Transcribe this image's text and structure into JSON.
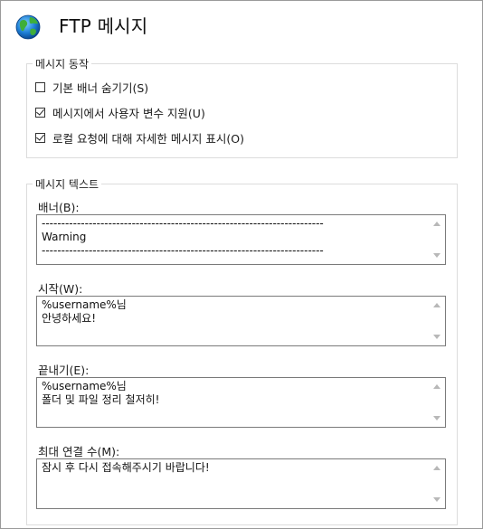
{
  "window": {
    "title": "FTP 메시지",
    "icon": "globe-icon"
  },
  "behavior_group": {
    "legend": "메시지 동작",
    "options": [
      {
        "label": "기본 배너 숨기기(S)",
        "checked": false
      },
      {
        "label": "메시지에서 사용자 변수 지원(U)",
        "checked": true
      },
      {
        "label": "로컬 요청에 대해 자세한 메시지 표시(O)",
        "checked": true
      }
    ]
  },
  "text_group": {
    "legend": "메시지 텍스트",
    "banner": {
      "label": "배너(B):",
      "value": "------------------------------------------------------------------------\nWarning\n------------------------------------------------------------------------"
    },
    "welcome": {
      "label": "시작(W):",
      "value": "%username%님\n안녕하세요!"
    },
    "exit": {
      "label": "끝내기(E):",
      "value": "%username%님\n폴더 및 파일 정리 철저히!"
    },
    "max_connections": {
      "label": "최대 연결 수(M):",
      "value": "잠시 후 다시 접속해주시기 바랍니다!"
    }
  }
}
